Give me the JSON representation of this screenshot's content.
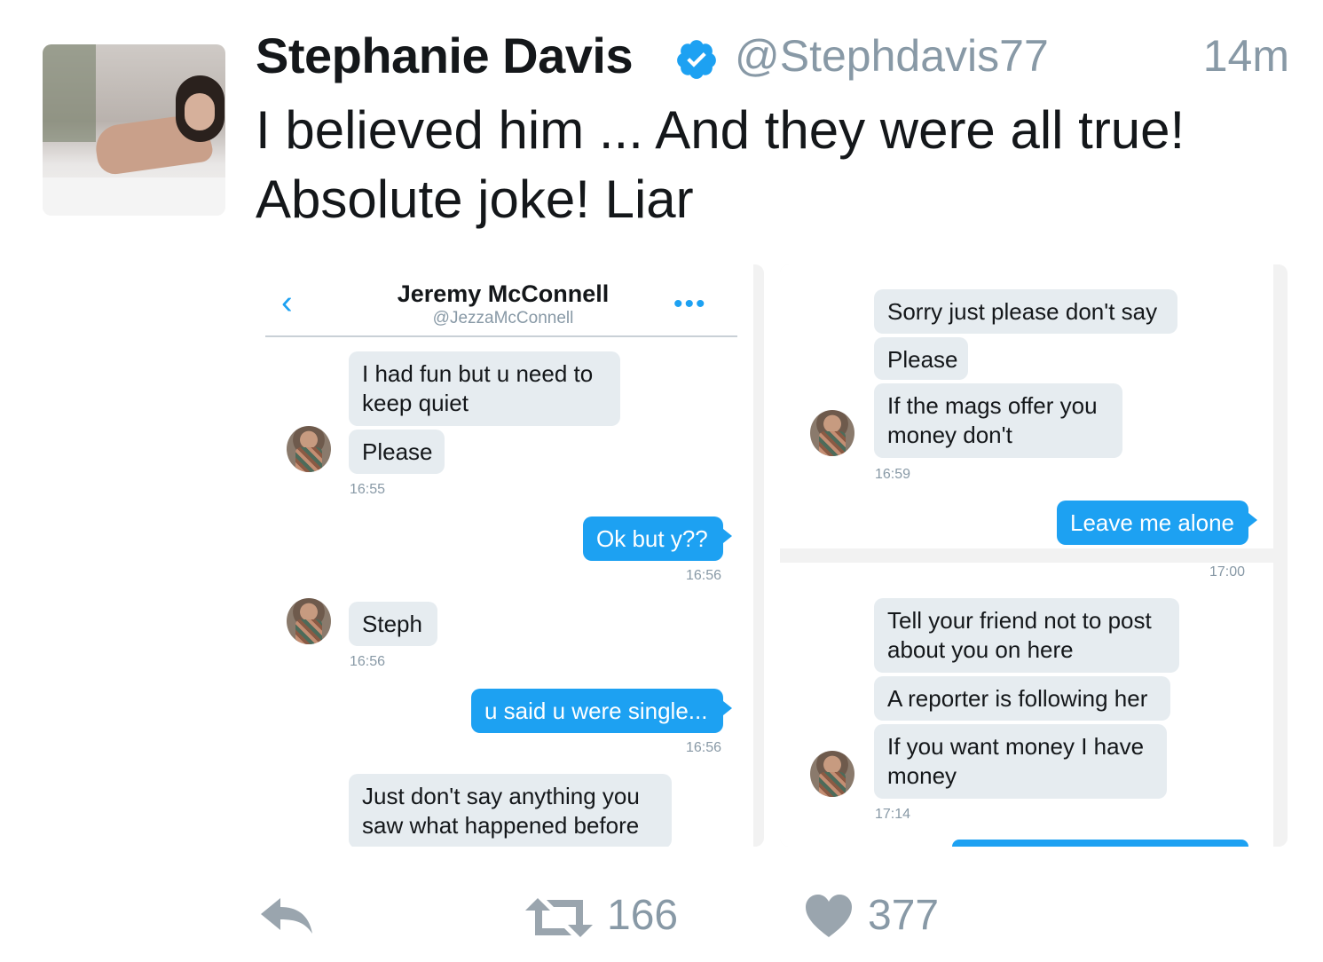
{
  "tweet": {
    "author_name": "Stephanie Davis",
    "handle": "@Stephdavis77",
    "time": "14m",
    "text_line1": "I believed him ... And they were all true!",
    "text_line2": "Absolute joke! Liar",
    "colors": {
      "verified": "#1da1f2",
      "muted": "#8899a6",
      "text": "#14171a"
    }
  },
  "dm_left": {
    "back_icon": "chevron-left-icon",
    "name": "Jeremy McConnell",
    "handle": "@JezzaMcConnell",
    "more_icon": "more-dots-icon",
    "messages": [
      {
        "text_lines": [
          "I had fun but u need to",
          "keep quiet"
        ]
      },
      {
        "text": "Please"
      },
      {
        "ts": "16:55"
      },
      {
        "text": "Ok but y??"
      },
      {
        "ts": "16:56"
      },
      {
        "text": "Steph"
      },
      {
        "ts": "16:56"
      },
      {
        "text": "u said u were single..."
      },
      {
        "ts": "16:56"
      },
      {
        "text_lines": [
          "Just don't say anything you",
          "saw what happened before"
        ]
      }
    ]
  },
  "dm_right": {
    "messages": [
      {
        "text": "Sorry just please don't say"
      },
      {
        "text": "Please"
      },
      {
        "text_lines": [
          "If the mags offer you",
          "money don't"
        ]
      },
      {
        "ts": "16:59"
      },
      {
        "text": "Leave me alone"
      },
      {
        "ts": "17:00"
      },
      {
        "text_lines": [
          "Tell your friend not to post",
          "about you on here"
        ]
      },
      {
        "text": "A reporter is following her"
      },
      {
        "text_lines": [
          "If you want money I have",
          "money"
        ]
      },
      {
        "ts": "17:14"
      }
    ]
  },
  "actions": {
    "reply_icon": "reply-icon",
    "retweet_icon": "retweet-icon",
    "retweet_count": "166",
    "like_icon": "heart-icon",
    "like_count": "377"
  }
}
